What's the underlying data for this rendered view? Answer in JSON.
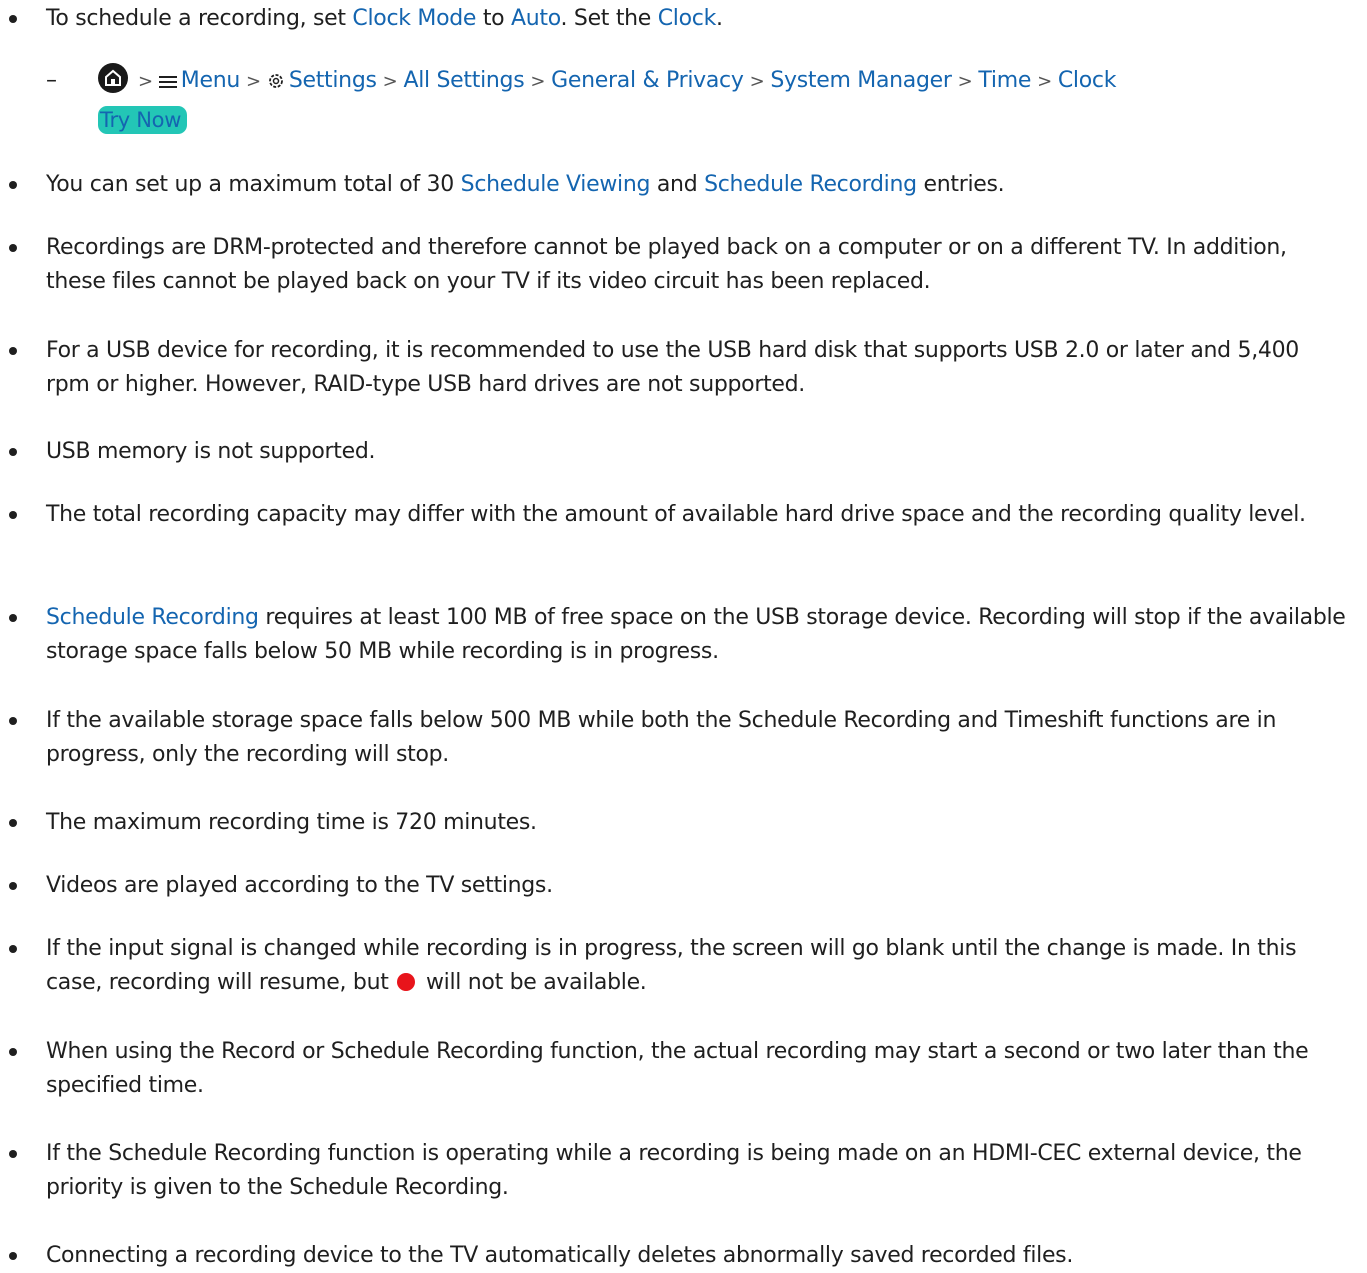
{
  "bullets": {
    "b1": {
      "text1": "To schedule a recording, set ",
      "link1": "Clock Mode",
      "text2": " to ",
      "link2": "Auto",
      "text3": ". Set the ",
      "link3": "Clock",
      "text4": "."
    },
    "path": {
      "dash": "–",
      "sep": ">",
      "menu": "Menu",
      "settings": "Settings",
      "all_settings": "All Settings",
      "general": "General & Privacy",
      "system": "System Manager",
      "time": "Time",
      "clock": "Clock",
      "try_now": "Try Now"
    },
    "b2": {
      "text1": "You can set up a maximum total of 30 ",
      "link1": "Schedule Viewing",
      "text2": " and ",
      "link2": "Schedule Recording",
      "text3": " entries."
    },
    "b3": "Recordings are DRM-protected and therefore cannot be played back on a computer or on a different TV. In addition, these files cannot be played back on your TV if its video circuit has been replaced.",
    "b4": "For a USB device for recording, it is recommended to use the USB hard disk that supports USB 2.0 or later and 5,400 rpm or higher. However, RAID-type USB hard drives are not supported.",
    "b5": "USB memory is not supported.",
    "b6": "The total recording capacity may differ with the amount of available hard drive space and the recording quality level.",
    "b7": {
      "link1": "Schedule Recording",
      "text1": " requires at least 100 MB of free space on the USB storage device. Recording will stop if the available storage space falls below 50 MB while recording is in progress."
    },
    "b8": "If the available storage space falls below 500 MB while both the Schedule Recording and Timeshift functions are in progress, only the recording will stop.",
    "b9": "The maximum recording time is 720 minutes.",
    "b10": "Videos are played according to the TV settings.",
    "b11": {
      "text1": "If the input signal is changed while recording is in progress, the screen will go blank until the change is made. In this case, recording will resume, but ",
      "text2": " will not be available."
    },
    "b12": "When using the Record or Schedule Recording function, the actual recording may start a second or two later than the specified time.",
    "b13": "If the Schedule Recording function is operating while a recording is being made on an HDMI-CEC external device, the priority is given to the Schedule Recording.",
    "b14": "Connecting a recording device to the TV automatically deletes abnormally saved recorded files."
  },
  "colors": {
    "link": "#1465b0",
    "try_now_bg": "#23c6b6",
    "record_dot": "#e8141b"
  },
  "icons": [
    "home-icon",
    "menu-icon",
    "gear-icon",
    "record-icon"
  ]
}
